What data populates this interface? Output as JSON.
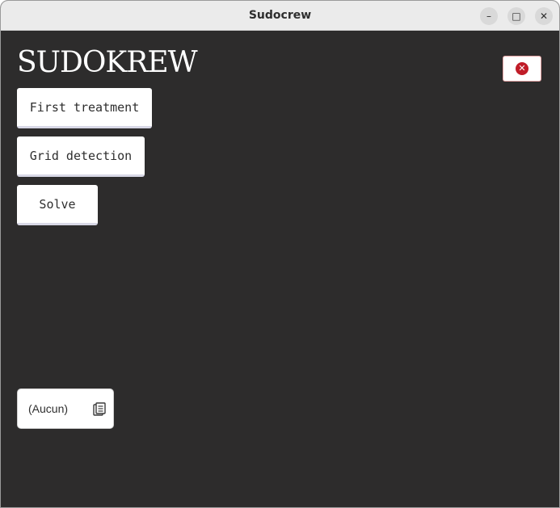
{
  "window": {
    "title": "Sudocrew",
    "controls": {
      "minimize": "–",
      "maximize": "□",
      "close": "✕"
    }
  },
  "header": {
    "app_title": "SUDOKREW"
  },
  "actions": {
    "first_treatment": "First treatment",
    "grid_detection": "Grid detection",
    "solve": "Solve"
  },
  "quit": {
    "icon": "close-circle-icon",
    "color": "#c01c28",
    "glyph": "✕"
  },
  "file_chooser": {
    "value": "(Aucun)",
    "icon": "document-open-icon"
  },
  "colors": {
    "background": "#2d2c2c",
    "titlebar": "#ebebeb",
    "button": "#ffffff"
  }
}
